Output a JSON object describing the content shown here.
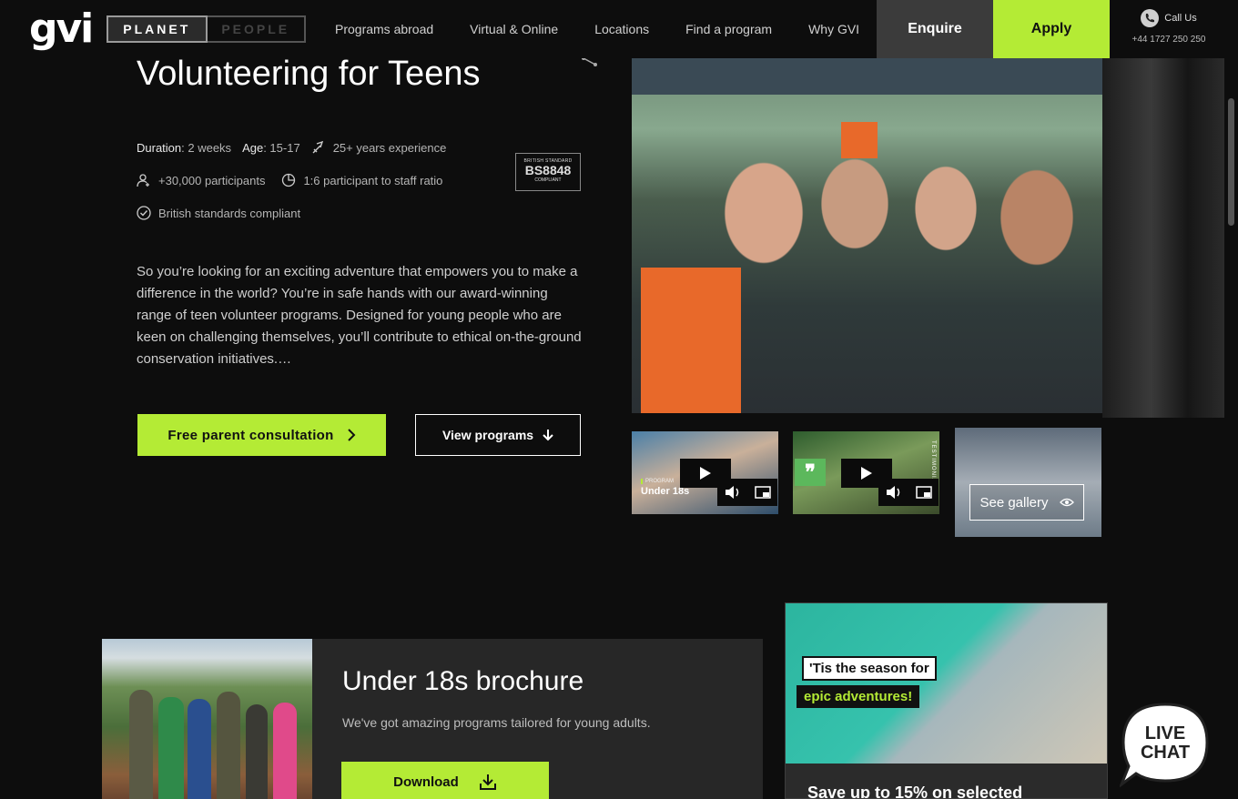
{
  "header": {
    "logo": "gvi",
    "toggle": {
      "active": "PLANET",
      "inactive": "PEOPLE"
    },
    "nav": [
      "Programs abroad",
      "Virtual & Online",
      "Locations",
      "Find a program",
      "Why GVI"
    ],
    "enquire": "Enquire",
    "apply": "Apply",
    "call_label": "Call Us",
    "call_number": "+44 1727 250 250"
  },
  "hero": {
    "title": "Volunteering for Teens",
    "duration_label": "Duration",
    "duration_value": ": 2 weeks",
    "age_label": "Age",
    "age_value": ": 15-17",
    "experience": "25+ years experience",
    "participants": "+30,000 participants",
    "ratio": "1:6 participant to staff ratio",
    "compliance": "British standards compliant",
    "badge": {
      "top": "BRITISH STANDARD",
      "main": "BS8848",
      "bottom": "COMPLIANT"
    },
    "description": "So you’re looking for an exciting adventure that empowers you to make a difference in the world? You’re in safe hands with our award-winning range of teen volunteer programs. Designed for young people who are keen on challenging themselves, you’ll contribute to ethical on-the-ground conservation initiatives.…",
    "consult_button": "Free parent consultation",
    "view_button": "View programs"
  },
  "media": {
    "thumb1_tag": "PROGRAM",
    "thumb1_title": "Under 18s",
    "thumb2_vertical": "TESTIMONIAL",
    "gallery_button": "See gallery"
  },
  "brochure": {
    "title": "Under 18s brochure",
    "subtitle": "We've got amazing programs tailored for young adults.",
    "download": "Download"
  },
  "promo": {
    "tag1": "'Tis the season for",
    "tag2": "epic adventures!",
    "text": "Save up to 15% on selected"
  },
  "livechat": {
    "line1": "LIVE",
    "line2": "CHAT"
  },
  "colors": {
    "accent": "#b4eb35",
    "background": "#0d0d0d",
    "panel": "#272727"
  }
}
